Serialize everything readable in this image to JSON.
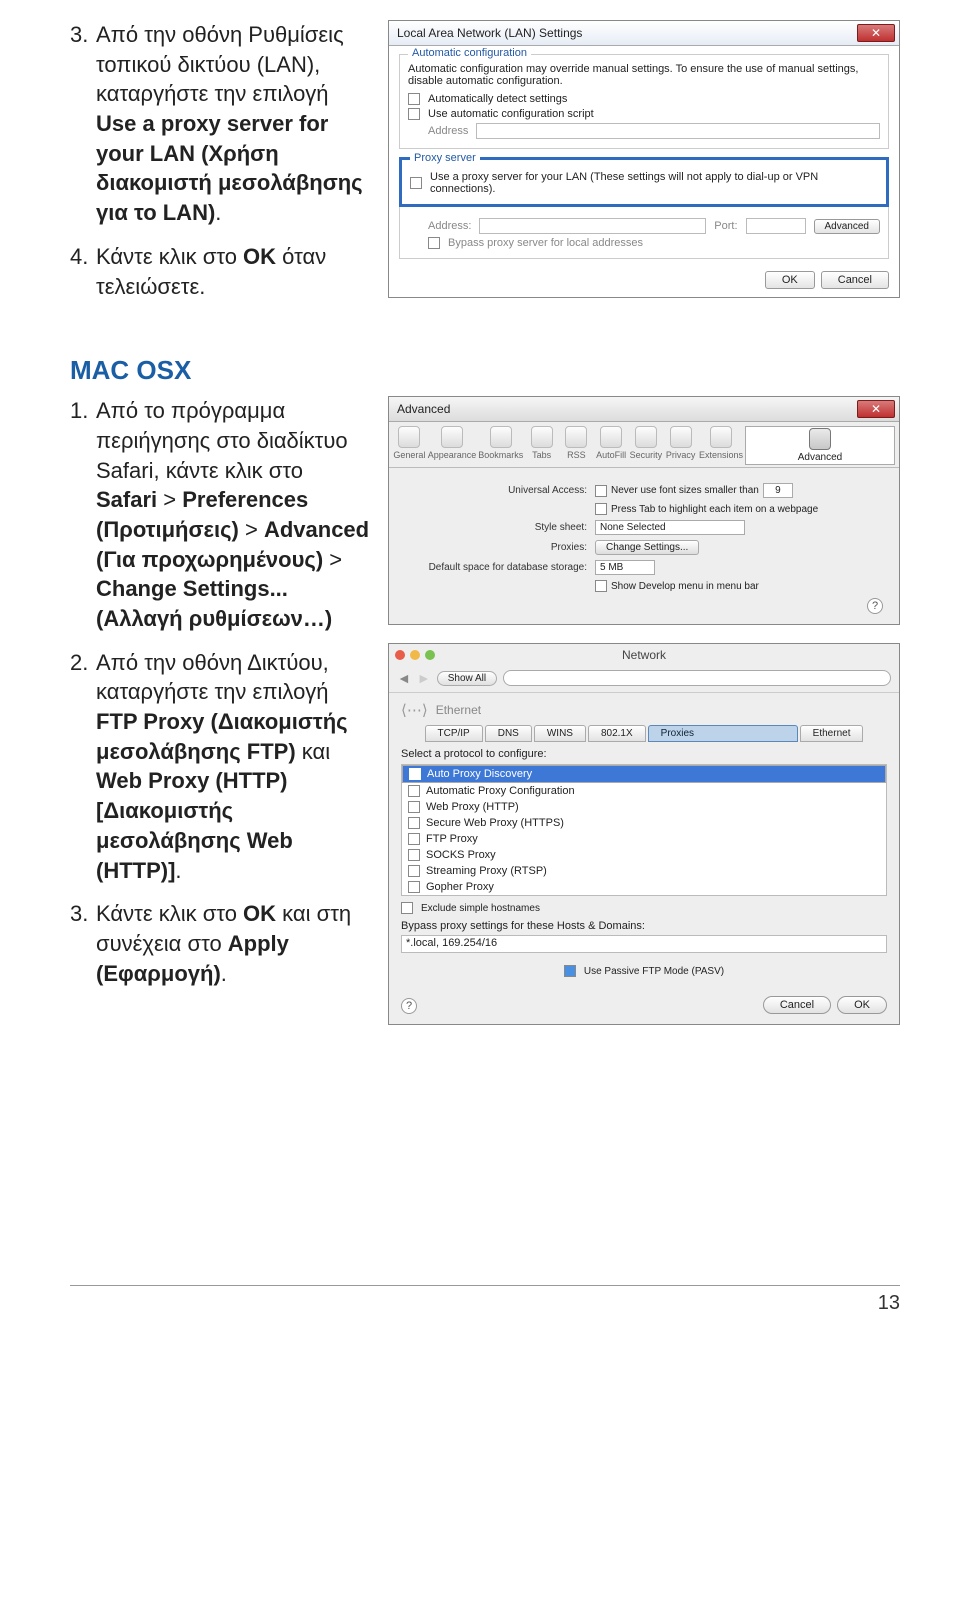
{
  "step3": {
    "num": "3.",
    "t1": "Από την οθόνη Ρυθμίσεις τοπικού δικτύου (LAN), καταργήστε την επιλογή ",
    "b1": "Use a proxy server for your LAN (Χρήση διακομιστή μεσολάβησης για το LAN)",
    "t2": "."
  },
  "step4": {
    "num": "4.",
    "t1": "Κάντε κλικ στο ",
    "b1": "OK",
    "t2": " όταν τελειώσετε."
  },
  "lan": {
    "title": "Local Area Network (LAN) Settings",
    "grp1": "Automatic configuration",
    "g1a": "Automatic configuration may override manual settings. To ensure the use of manual settings, disable automatic configuration.",
    "g1b": "Automatically detect settings",
    "g1c": "Use automatic configuration script",
    "addr": "Address",
    "grp2": "Proxy server",
    "g2a": "Use a proxy server for your LAN (These settings will not apply to dial-up or VPN connections).",
    "g2addr": "Address:",
    "g2port": "Port:",
    "g2adv": "Advanced",
    "g2bypass": "Bypass proxy server for local addresses",
    "ok": "OK",
    "cancel": "Cancel"
  },
  "macHeading": "MAC OSX",
  "m1": {
    "num": "1.",
    "t1": "Από το πρόγραμμα περιήγησης στο διαδίκτυο Safari, κάντε κλικ στο ",
    "b1": "Safari",
    "t2": " > ",
    "b2": "Preferences (Προτιμήσεις)",
    "t3": " > ",
    "b3": "Advanced (Για προχωρημένους)",
    "t4": " > ",
    "b4": "Change Settings... (Αλλαγή ρυθμίσεων…)"
  },
  "m2": {
    "num": "2.",
    "t1": "Από την οθόνη Δικτύου, καταργήστε την επιλογή ",
    "b1": "FTP Proxy (Διακομιστής μεσολάβησης FTP)",
    "t2": " και ",
    "b2": "Web Proxy (HTTP) [Διακομιστής μεσολάβησης Web (HTTP)]",
    "t3": "."
  },
  "m3": {
    "num": "3.",
    "t1": "Κάντε κλικ στο ",
    "b1": "OK",
    "t2": " και στη συνέχεια στο ",
    "b2": "Apply (Εφαρμογή)",
    "t3": "."
  },
  "adv": {
    "title": "Advanced",
    "icons": [
      "General",
      "Appearance",
      "Bookmarks",
      "Tabs",
      "RSS",
      "AutoFill",
      "Security",
      "Privacy",
      "Extensions",
      "Advanced"
    ],
    "ua": "Universal Access:",
    "uaChk": "Never use font sizes smaller than",
    "uaVal": "9",
    "press": "Press Tab to highlight each item on a webpage",
    "ss": "Style sheet:",
    "ssVal": "None Selected",
    "px": "Proxies:",
    "pxBtn": "Change Settings...",
    "db": "Default space for database storage:",
    "dbVal": "5 MB",
    "dev": "Show Develop menu in menu bar"
  },
  "net": {
    "title": "Network",
    "showAll": "Show All",
    "eth": "Ethernet",
    "tabs": [
      "TCP/IP",
      "DNS",
      "WINS",
      "802.1X",
      "Proxies",
      "Ethernet"
    ],
    "protoLabel": "Select a protocol to configure:",
    "protos": [
      "Auto Proxy Discovery",
      "Automatic Proxy Configuration",
      "Web Proxy (HTTP)",
      "Secure Web Proxy (HTTPS)",
      "FTP Proxy",
      "SOCKS Proxy",
      "Streaming Proxy (RTSP)",
      "Gopher Proxy"
    ],
    "excl": "Exclude simple hostnames",
    "bypass": "Bypass proxy settings for these Hosts & Domains:",
    "bypassVal": "*.local, 169.254/16",
    "pasv": "Use Passive FTP Mode (PASV)",
    "cancel": "Cancel",
    "ok": "OK"
  },
  "pageNum": "13"
}
